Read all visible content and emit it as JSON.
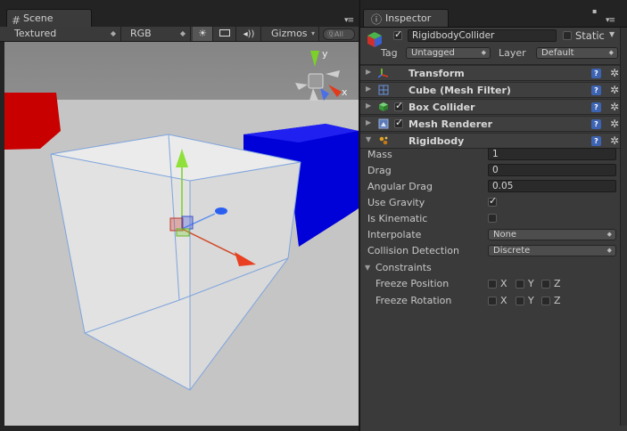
{
  "scene": {
    "tab_label": "Scene",
    "toolbar": {
      "render_mode": "Textured",
      "color_mode": "RGB",
      "gizmos_label": "Gizmos",
      "search_placeholder": "ⓆAll"
    },
    "orientation_gizmo": {
      "y_label": "y",
      "x_label": "x"
    }
  },
  "inspector": {
    "tab_label": "Inspector",
    "object": {
      "active": true,
      "name": "RigidbodyCollider",
      "static_label": "Static",
      "static": false,
      "tag_label": "Tag",
      "tag_value": "Untagged",
      "layer_label": "Layer",
      "layer_value": "Default"
    },
    "components": [
      {
        "name": "Transform",
        "icon": "transform-icon",
        "has_checkbox": false
      },
      {
        "name": "Cube (Mesh Filter)",
        "icon": "mesh-filter-icon",
        "has_checkbox": false
      },
      {
        "name": "Box Collider",
        "icon": "box-collider-icon",
        "has_checkbox": true,
        "enabled": true
      },
      {
        "name": "Mesh Renderer",
        "icon": "mesh-renderer-icon",
        "has_checkbox": true,
        "enabled": true
      },
      {
        "name": "Rigidbody",
        "icon": "rigidbody-icon",
        "has_checkbox": false,
        "expanded": true
      }
    ],
    "rigidbody": {
      "mass_label": "Mass",
      "mass": "1",
      "drag_label": "Drag",
      "drag": "0",
      "angular_drag_label": "Angular Drag",
      "angular_drag": "0.05",
      "use_gravity_label": "Use Gravity",
      "use_gravity": true,
      "is_kinematic_label": "Is Kinematic",
      "is_kinematic": false,
      "interpolate_label": "Interpolate",
      "interpolate": "None",
      "collision_label": "Collision Detection",
      "collision": "Discrete",
      "constraints_label": "Constraints",
      "freeze_position_label": "Freeze Position",
      "freeze_rotation_label": "Freeze Rotation",
      "axes": [
        "X",
        "Y",
        "Z"
      ]
    }
  },
  "colors": {
    "panel_bg": "#3a3a3a",
    "accent_red": "#c80000",
    "accent_blue": "#0000d8",
    "help_blue": "#3d63b3"
  }
}
